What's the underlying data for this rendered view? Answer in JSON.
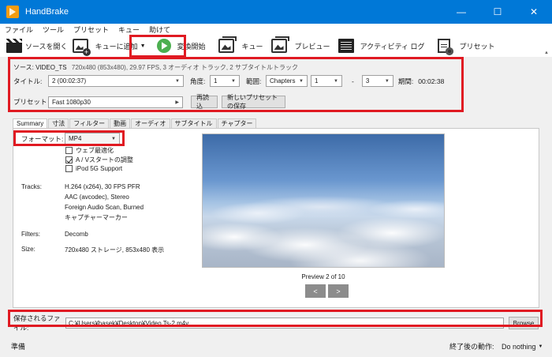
{
  "window": {
    "title": "HandBrake",
    "minimize": "—",
    "maximize": "☐",
    "close": "✕"
  },
  "menu": [
    "ファイル",
    "ツール",
    "プリセット",
    "キュー",
    "助けて"
  ],
  "toolbar": {
    "open_source": "ソースを開く",
    "add_queue": "キューに追加",
    "start": "変換開始",
    "queue": "キュー",
    "preview": "プレビュー",
    "activity": "アクティビティ ログ",
    "presets": "プリセット"
  },
  "source": {
    "label": "ソース:",
    "name": "VIDEO_TS",
    "info": "720x480 (853x480), 29.97 FPS, 3 オーディオ トラック, 2 サブタイトルトラック"
  },
  "title_row": {
    "title_label": "タイトル:",
    "title_value": "2 (00:02:37)",
    "angle_label": "角度:",
    "angle_value": "1",
    "range_label": "範囲:",
    "range_type": "Chapters",
    "range_start": "1",
    "range_dash": "-",
    "range_end": "3",
    "duration_label": "期間:",
    "duration_value": "00:02:38"
  },
  "preset_row": {
    "label": "プリセット",
    "value": "Fast 1080p30",
    "reload": "再読込",
    "save_new": "新しいプリセットの保存"
  },
  "tabs": [
    "Summary",
    "寸法",
    "フィルター",
    "動画",
    "オーディオ",
    "サブタイトル",
    "チャプター"
  ],
  "summary": {
    "format_label": "フォーマット:",
    "format_value": "MP4",
    "web_optimize": "ウェブ最適化",
    "av_align": "A / Vスタートの調整",
    "ipod": "iPod 5G Support",
    "tracks_label": "Tracks:",
    "tracks": [
      "H.264 (x264), 30 FPS PFR",
      "AAC (avcodec), Stereo",
      "Foreign Audio Scan, Burned",
      "キャプチャーマーカー"
    ],
    "filters_label": "Filters:",
    "filters_value": "Decomb",
    "size_label": "Size:",
    "size_value": "720x480 ストレージ, 853x480 表示"
  },
  "preview": {
    "caption": "Preview 2 of 10",
    "prev": "<",
    "next": ">"
  },
  "save": {
    "label": "保存されるファイル:",
    "path": "C:¥Users¥hasek¥Desktop¥Video Ts-2.m4v",
    "browse": "Browse"
  },
  "status": {
    "left": "準備",
    "after_label": "終了後の動作:",
    "after_value": "Do nothing"
  }
}
